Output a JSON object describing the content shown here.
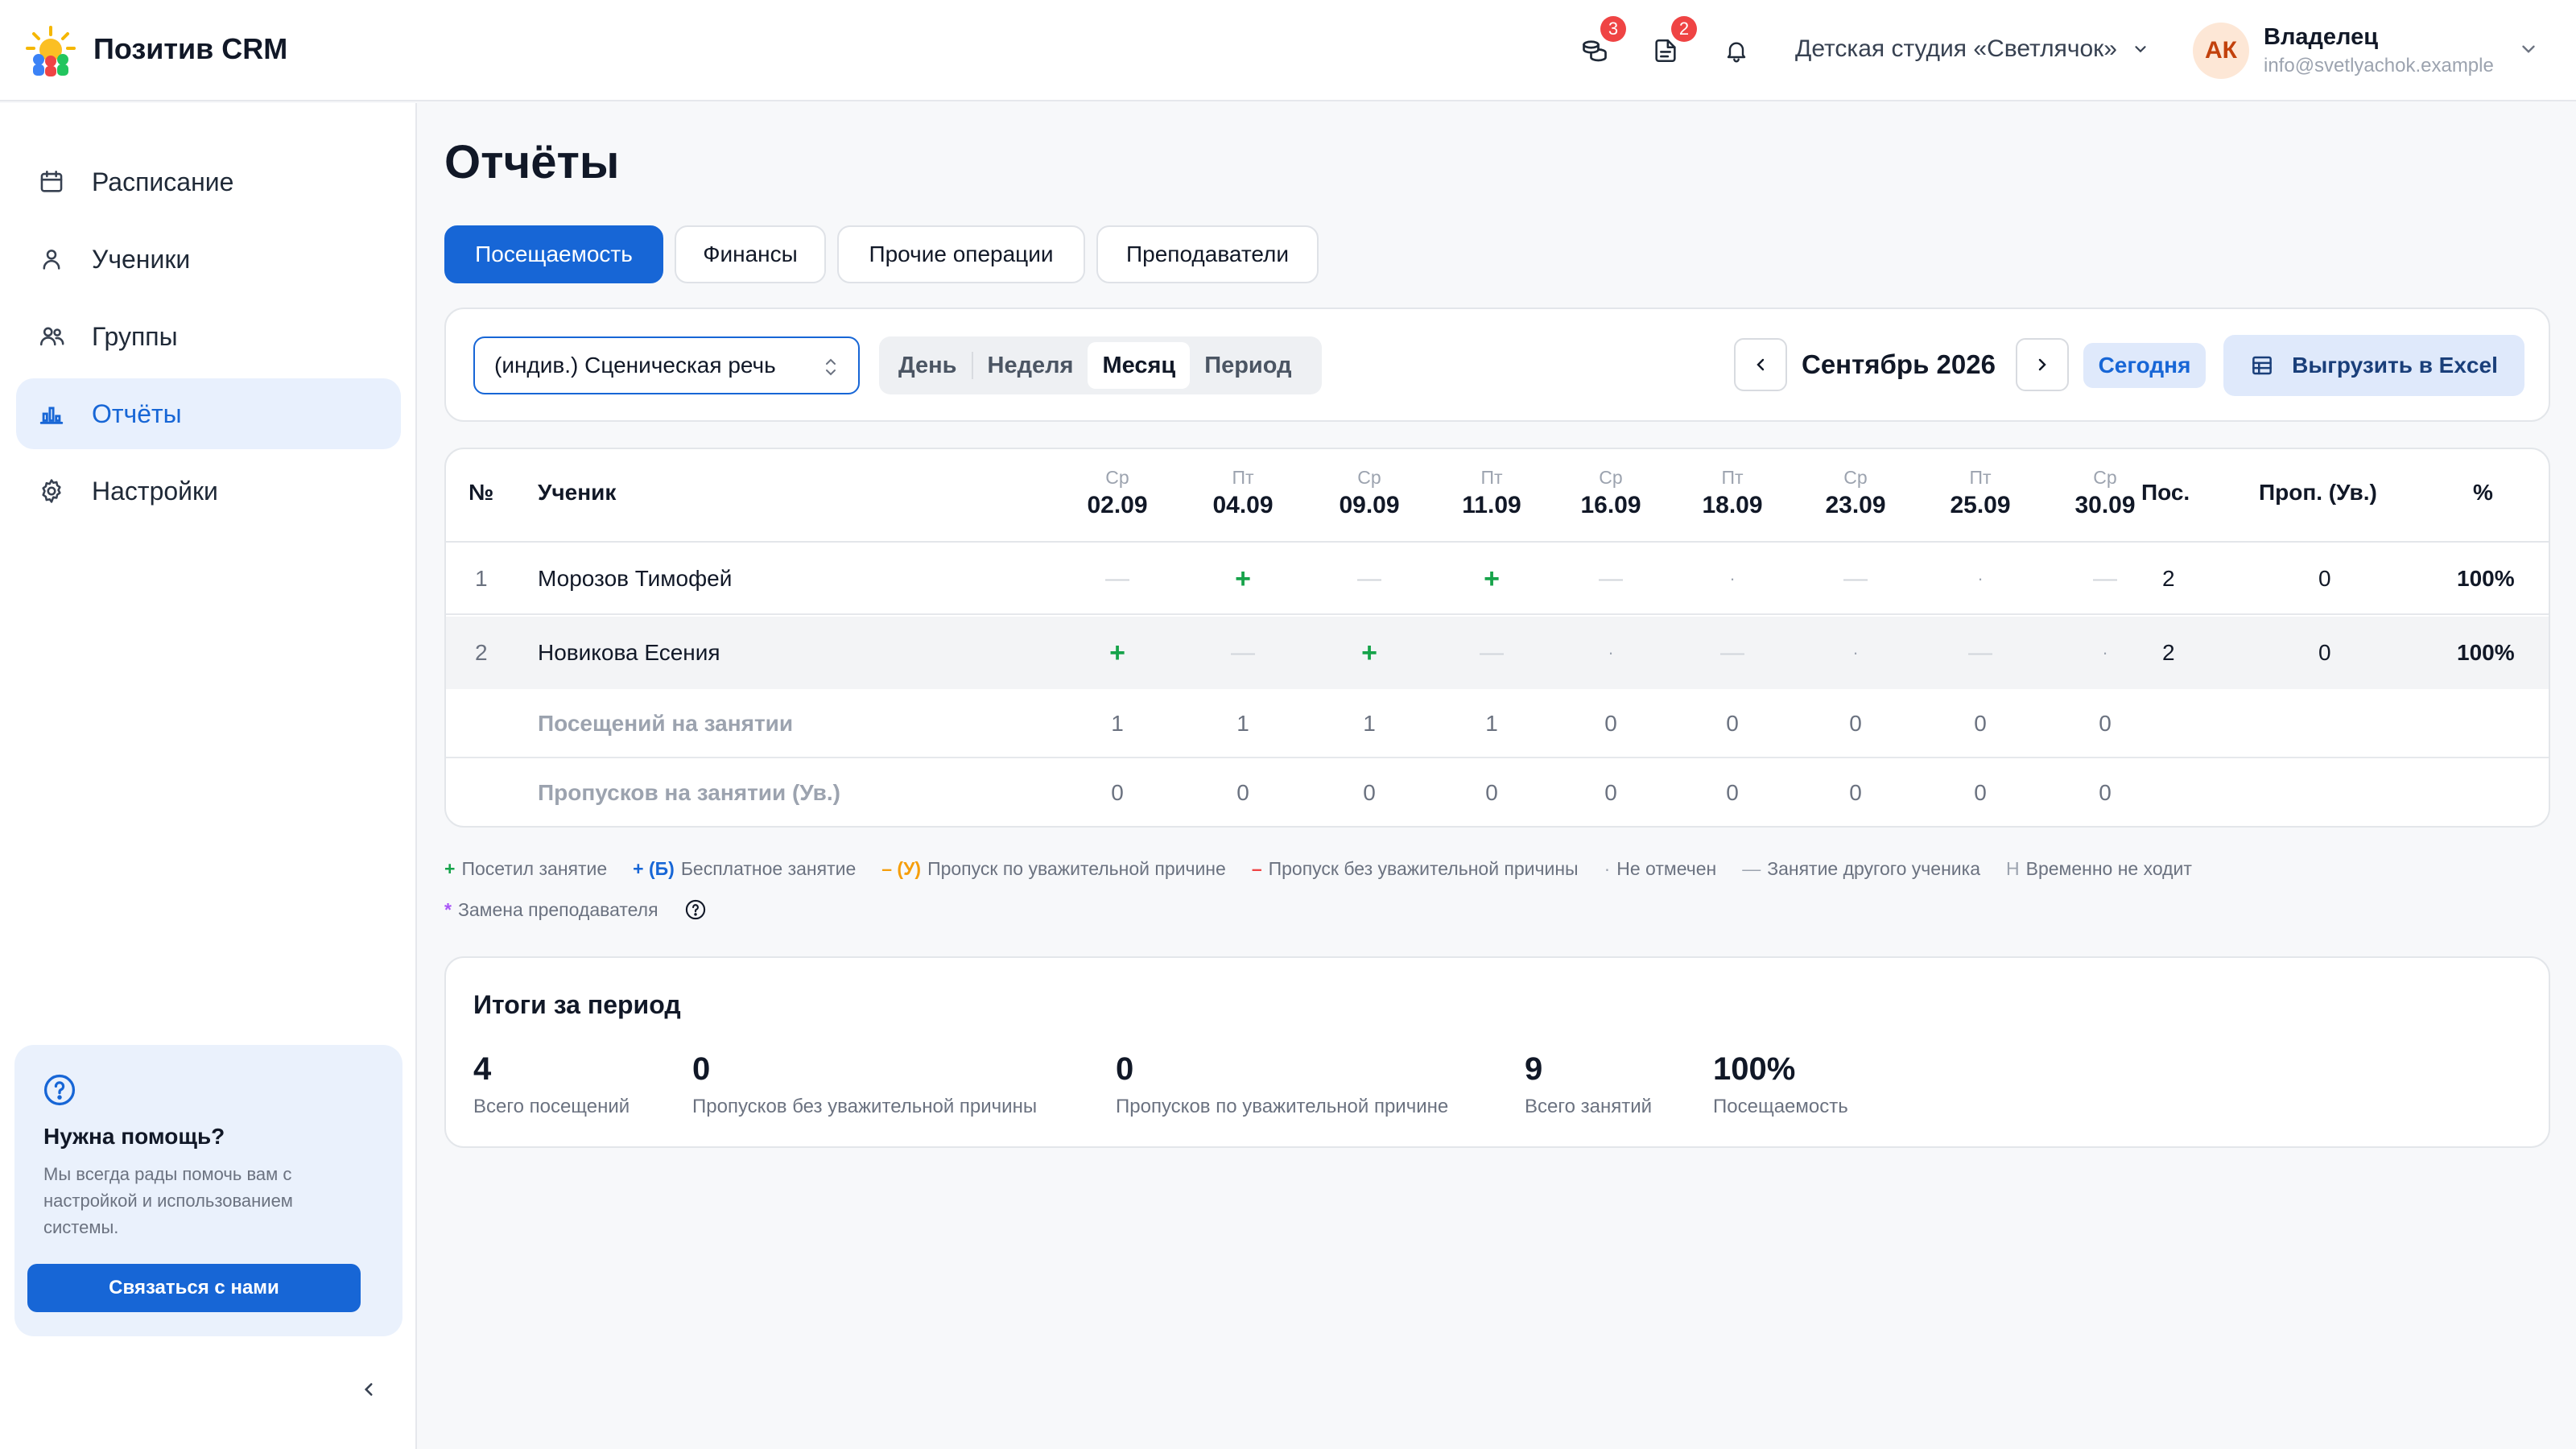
{
  "app": {
    "title": "Позитив CRM",
    "badges": {
      "payments": "3",
      "documents": "2"
    },
    "studio": "Детская студия «Светлячок»",
    "user": {
      "initials": "АК",
      "role": "Владелец",
      "email": "info@svetlyachok.example"
    }
  },
  "sidebar": {
    "items": [
      {
        "label": "Расписание",
        "icon": "calendar-icon"
      },
      {
        "label": "Ученики",
        "icon": "user-icon"
      },
      {
        "label": "Группы",
        "icon": "users-icon"
      },
      {
        "label": "Отчёты",
        "icon": "chart-icon",
        "active": true
      },
      {
        "label": "Настройки",
        "icon": "gear-icon"
      }
    ],
    "help": {
      "title": "Нужна помощь?",
      "text": "Мы всегда рады помочь вам с настройкой и использованием системы.",
      "button": "Связаться с нами"
    }
  },
  "page": {
    "title": "Отчёты",
    "tabs": [
      "Посещаемость",
      "Финансы",
      "Прочие операции",
      "Преподаватели"
    ],
    "active_tab": "Посещаемость"
  },
  "filters": {
    "course": "(индив.) Сценическая речь",
    "periods": [
      "День",
      "Неделя",
      "Месяц",
      "Период"
    ],
    "active_period": "Месяц",
    "month": "Сентябрь 2026",
    "today": "Сегодня",
    "export": "Выгрузить в Excel"
  },
  "table": {
    "headers": {
      "num": "№",
      "student": "Ученик",
      "visits": "Пос.",
      "absences": "Проп. (Ув.)",
      "percent": "%"
    },
    "days": [
      {
        "dow": "Ср",
        "date": "02.09"
      },
      {
        "dow": "Пт",
        "date": "04.09"
      },
      {
        "dow": "Ср",
        "date": "09.09"
      },
      {
        "dow": "Пт",
        "date": "11.09"
      },
      {
        "dow": "Ср",
        "date": "16.09"
      },
      {
        "dow": "Пт",
        "date": "18.09"
      },
      {
        "dow": "Ср",
        "date": "23.09"
      },
      {
        "dow": "Пт",
        "date": "25.09"
      },
      {
        "dow": "Ср",
        "date": "30.09"
      }
    ],
    "rows": [
      {
        "num": "1",
        "name": "Морозов Тимофей",
        "marks": [
          "—",
          "+",
          "—",
          "+",
          "—",
          "·",
          "—",
          "·",
          "—"
        ],
        "visits": "2",
        "absences": "0",
        "percent": "100%"
      },
      {
        "num": "2",
        "name": "Новикова Есения",
        "marks": [
          "+",
          "—",
          "+",
          "—",
          "·",
          "—",
          "·",
          "—",
          "·"
        ],
        "visits": "2",
        "absences": "0",
        "percent": "100%"
      }
    ],
    "totals": [
      {
        "label": "Посещений на занятии",
        "values": [
          "1",
          "1",
          "1",
          "1",
          "0",
          "0",
          "0",
          "0",
          "0"
        ]
      },
      {
        "label": "Пропусков на занятии (Ув.)",
        "values": [
          "0",
          "0",
          "0",
          "0",
          "0",
          "0",
          "0",
          "0",
          "0"
        ]
      }
    ]
  },
  "legend": {
    "items": [
      {
        "symbol": "+",
        "label": "Посетил занятие",
        "color": "#16a34a"
      },
      {
        "symbol": "+ (Б)",
        "label": "Бесплатное занятие",
        "color": "#1766d6"
      },
      {
        "symbol": "– (У)",
        "label": "Пропуск по уважительной причине",
        "color": "#f59e0b"
      },
      {
        "symbol": "–",
        "label": "Пропуск без уважительной причины",
        "color": "#ef4444"
      },
      {
        "symbol": "·",
        "label": "Не отмечен",
        "color": "#9ca3af"
      },
      {
        "symbol": "—",
        "label": "Занятие другого ученика",
        "color": "#9ca3af"
      },
      {
        "symbol": "Н",
        "label": "Временно не ходит",
        "color": "#9ca3af"
      },
      {
        "symbol": "*",
        "label": "Замена преподавателя",
        "color": "#a855f7"
      }
    ]
  },
  "summary": {
    "title": "Итоги за период",
    "stats": [
      {
        "value": "4",
        "label": "Всего посещений"
      },
      {
        "value": "0",
        "label": "Пропусков без уважительной причины"
      },
      {
        "value": "0",
        "label": "Пропусков по уважительной причине"
      },
      {
        "value": "9",
        "label": "Всего занятий"
      },
      {
        "value": "100%",
        "label": "Посещаемость"
      }
    ]
  },
  "colors": {
    "accent": "#1766d6",
    "present": "#16a34a",
    "badge": "#ef4444"
  }
}
